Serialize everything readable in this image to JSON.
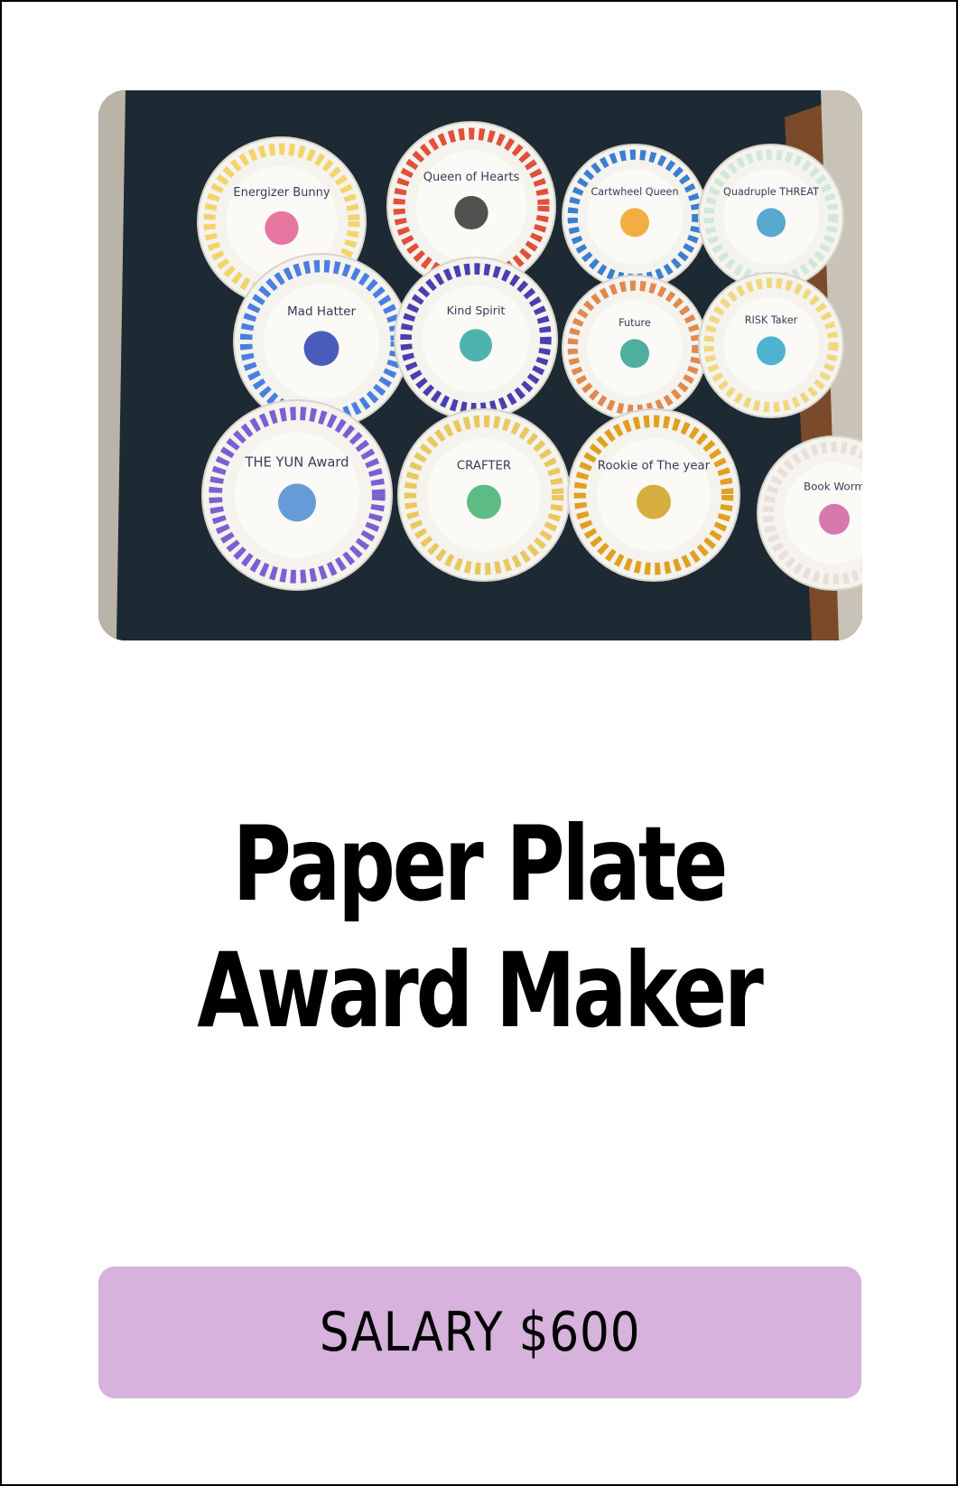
{
  "photo": {
    "alt": "Paper plates decorated as awards",
    "plates": [
      {
        "label": "Energizer Bunny",
        "rim": "#f2d46a",
        "accent": "#e25d8f"
      },
      {
        "label": "Queen of Hearts",
        "rim": "#e0503a",
        "accent": "#333333"
      },
      {
        "label": "Cartwheel Queen",
        "rim": "#3a7fd0",
        "accent": "#f0a020"
      },
      {
        "label": "Quadruple THREAT",
        "rim": "#cfe8d8",
        "accent": "#3a9ac8"
      },
      {
        "label": "Mad Hatter",
        "rim": "#4a7fe0",
        "accent": "#2a3fb0"
      },
      {
        "label": "Kind Spirit",
        "rim": "#4a3fb0",
        "accent": "#2fa6a0"
      },
      {
        "label": "Future",
        "rim": "#e08a50",
        "accent": "#2fa090"
      },
      {
        "label": "RISK Taker",
        "rim": "#f0d880",
        "accent": "#2fa6c8"
      },
      {
        "label": "THE YUN Award",
        "rim": "#7a60d0",
        "accent": "#4a8ad0"
      },
      {
        "label": "CRAFTER",
        "rim": "#e8c860",
        "accent": "#3fb070"
      },
      {
        "label": "Rookie of The year",
        "rim": "#e0a020",
        "accent": "#d0a020"
      },
      {
        "label": "Book Worm",
        "rim": "#e8e0d8",
        "accent": "#d060a0"
      }
    ]
  },
  "title": {
    "line1": "Paper Plate",
    "line2": "Award Maker"
  },
  "salary": {
    "label": "SALARY $600"
  },
  "colors": {
    "salary_bar": "#d6b2dc",
    "border": "#000000",
    "background": "#ffffff"
  }
}
